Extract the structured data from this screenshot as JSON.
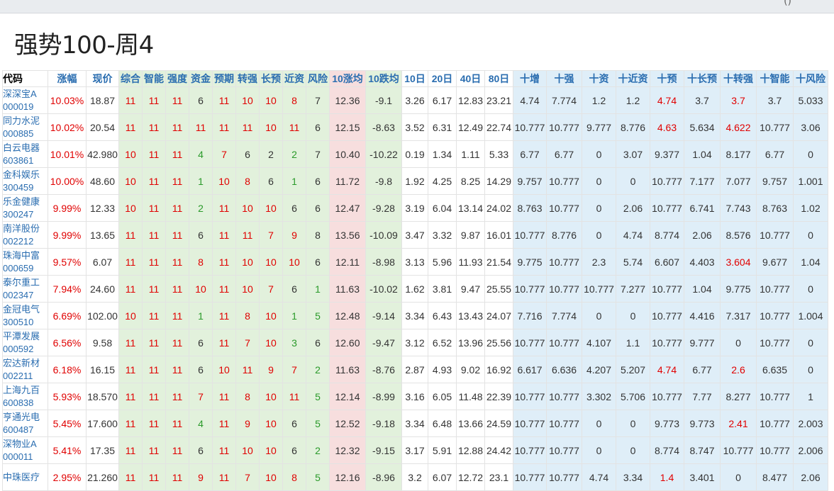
{
  "page_title": "强势100-周4",
  "top_mark": "()",
  "colors": {
    "red": "#e00000",
    "green": "#2a9a2a",
    "header_blue": "#2a6db0",
    "green_bg": "#e2f1dc",
    "pink_bg": "#f7dede",
    "blue_bg": "#dfeef8"
  },
  "columns": [
    "代码",
    "涨幅",
    "现价",
    "综合",
    "智能",
    "强度",
    "资金",
    "预期",
    "转强",
    "长预",
    "近资",
    "风险",
    "10涨均",
    "10跌均",
    "10日",
    "20日",
    "40日",
    "80日",
    "十增",
    "十强",
    "十资",
    "十近资",
    "十预",
    "十长预",
    "十转强",
    "十智能",
    "十风险"
  ],
  "rows": [
    {
      "name": "深深宝A",
      "code": "000019",
      "c": [
        "10.03%",
        "18.87",
        "11",
        "11",
        "11",
        "6",
        "11",
        "10",
        "10",
        "8",
        "7",
        "12.36",
        "-9.1",
        "3.26",
        "6.17",
        "12.83",
        "23.21",
        "4.74",
        "7.774",
        "1.2",
        "1.2",
        "4.74",
        "3.7",
        "3.7",
        "3.7",
        "5.033"
      ]
    },
    {
      "name": "同力水泥",
      "code": "000885",
      "c": [
        "10.02%",
        "20.54",
        "11",
        "11",
        "11",
        "11",
        "11",
        "11",
        "10",
        "11",
        "6",
        "12.15",
        "-8.63",
        "3.52",
        "6.31",
        "12.49",
        "22.74",
        "10.777",
        "10.777",
        "9.777",
        "8.776",
        "4.63",
        "5.634",
        "4.622",
        "10.777",
        "3.06"
      ]
    },
    {
      "name": "白云电器",
      "code": "603861",
      "c": [
        "10.01%",
        "42.980",
        "10",
        "11",
        "11",
        "4",
        "7",
        "6",
        "2",
        "2",
        "7",
        "10.40",
        "-10.22",
        "0.19",
        "1.34",
        "1.11",
        "5.33",
        "6.77",
        "6.77",
        "0",
        "3.07",
        "9.377",
        "1.04",
        "8.177",
        "6.77",
        "0"
      ]
    },
    {
      "name": "金科娱乐",
      "code": "300459",
      "c": [
        "10.00%",
        "48.60",
        "10",
        "11",
        "11",
        "1",
        "10",
        "8",
        "6",
        "1",
        "6",
        "11.72",
        "-9.8",
        "1.92",
        "4.25",
        "8.25",
        "14.29",
        "9.757",
        "10.777",
        "0",
        "0",
        "10.777",
        "7.177",
        "7.077",
        "9.757",
        "1.001"
      ]
    },
    {
      "name": "乐金健康",
      "code": "300247",
      "c": [
        "9.99%",
        "12.33",
        "10",
        "11",
        "11",
        "2",
        "11",
        "10",
        "10",
        "6",
        "6",
        "12.47",
        "-9.28",
        "3.19",
        "6.04",
        "13.14",
        "24.02",
        "8.763",
        "10.777",
        "0",
        "2.06",
        "10.777",
        "6.741",
        "7.743",
        "8.763",
        "1.02"
      ]
    },
    {
      "name": "南洋股份",
      "code": "002212",
      "c": [
        "9.99%",
        "13.65",
        "11",
        "11",
        "11",
        "6",
        "11",
        "11",
        "7",
        "9",
        "8",
        "13.56",
        "-10.09",
        "3.47",
        "3.32",
        "9.87",
        "16.01",
        "10.777",
        "8.776",
        "0",
        "4.74",
        "8.774",
        "2.06",
        "8.576",
        "10.777",
        "0"
      ]
    },
    {
      "name": "珠海中富",
      "code": "000659",
      "c": [
        "9.57%",
        "6.07",
        "11",
        "11",
        "11",
        "8",
        "11",
        "10",
        "10",
        "10",
        "6",
        "12.11",
        "-8.98",
        "3.13",
        "5.96",
        "11.93",
        "21.54",
        "9.775",
        "10.777",
        "2.3",
        "5.74",
        "6.607",
        "4.403",
        "3.604",
        "9.677",
        "1.04"
      ]
    },
    {
      "name": "泰尔重工",
      "code": "002347",
      "c": [
        "7.94%",
        "24.60",
        "11",
        "11",
        "11",
        "10",
        "11",
        "10",
        "7",
        "6",
        "1",
        "11.63",
        "-10.02",
        "1.62",
        "3.81",
        "9.47",
        "25.55",
        "10.777",
        "10.777",
        "10.777",
        "7.277",
        "10.777",
        "1.04",
        "9.775",
        "10.777",
        "0"
      ]
    },
    {
      "name": "金冠电气",
      "code": "300510",
      "c": [
        "6.69%",
        "102.00",
        "10",
        "11",
        "11",
        "1",
        "11",
        "8",
        "10",
        "1",
        "5",
        "12.48",
        "-9.14",
        "3.34",
        "6.43",
        "13.43",
        "24.07",
        "7.716",
        "7.774",
        "0",
        "0",
        "10.777",
        "4.416",
        "7.317",
        "10.777",
        "1.004"
      ]
    },
    {
      "name": "平潭发展",
      "code": "000592",
      "c": [
        "6.56%",
        "9.58",
        "11",
        "11",
        "11",
        "6",
        "11",
        "7",
        "10",
        "3",
        "6",
        "12.60",
        "-9.47",
        "3.12",
        "6.52",
        "13.96",
        "25.56",
        "10.777",
        "10.777",
        "4.107",
        "1.1",
        "10.777",
        "9.777",
        "0",
        "10.777",
        "0"
      ]
    },
    {
      "name": "宏达新材",
      "code": "002211",
      "c": [
        "6.18%",
        "16.15",
        "11",
        "11",
        "11",
        "6",
        "10",
        "11",
        "9",
        "7",
        "2",
        "11.63",
        "-8.76",
        "2.87",
        "4.93",
        "9.02",
        "16.92",
        "6.617",
        "6.636",
        "4.207",
        "5.207",
        "4.74",
        "6.77",
        "2.6",
        "6.635",
        "0"
      ]
    },
    {
      "name": "上海九百",
      "code": "600838",
      "c": [
        "5.93%",
        "18.570",
        "11",
        "11",
        "11",
        "7",
        "11",
        "8",
        "10",
        "11",
        "5",
        "12.14",
        "-8.99",
        "3.16",
        "6.05",
        "11.48",
        "22.39",
        "10.777",
        "10.777",
        "3.302",
        "5.706",
        "10.777",
        "7.77",
        "8.277",
        "10.777",
        "1"
      ]
    },
    {
      "name": "亨通光电",
      "code": "600487",
      "c": [
        "5.45%",
        "17.600",
        "11",
        "11",
        "11",
        "4",
        "11",
        "9",
        "10",
        "6",
        "5",
        "12.52",
        "-9.18",
        "3.34",
        "6.48",
        "13.66",
        "24.59",
        "10.777",
        "10.777",
        "0",
        "0",
        "9.773",
        "9.773",
        "2.41",
        "10.777",
        "2.003"
      ]
    },
    {
      "name": "深物业A",
      "code": "000011",
      "c": [
        "5.41%",
        "17.35",
        "11",
        "11",
        "11",
        "6",
        "11",
        "10",
        "10",
        "6",
        "2",
        "12.32",
        "-9.15",
        "3.17",
        "5.91",
        "12.88",
        "24.42",
        "10.777",
        "10.777",
        "0",
        "0",
        "8.774",
        "8.747",
        "10.777",
        "10.777",
        "2.006"
      ]
    },
    {
      "name": "中珠医疗",
      "code": "",
      "c": [
        "2.95%",
        "21.260",
        "11",
        "11",
        "11",
        "9",
        "11",
        "7",
        "10",
        "8",
        "5",
        "12.16",
        "-8.96",
        "3.2",
        "6.07",
        "12.72",
        "23.1",
        "10.777",
        "10.777",
        "4.74",
        "3.34",
        "1.4",
        "3.401",
        "0",
        "8.477",
        "2.06"
      ]
    }
  ]
}
